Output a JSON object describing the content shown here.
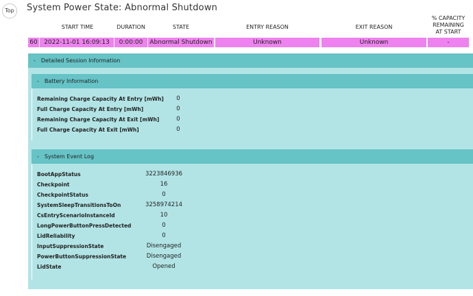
{
  "nav": {
    "top_label": "Top"
  },
  "page_title": "System Power State: Abnormal Shutdown",
  "columns": {
    "start_time": "START TIME",
    "duration": "DURATION",
    "state": "STATE",
    "entry_reason": "ENTRY REASON",
    "exit_reason": "EXIT REASON",
    "capacity_line1": "% CAPACITY",
    "capacity_line2": "REMAINING",
    "capacity_line3": "AT START"
  },
  "row": {
    "index": "60",
    "start_time": "2022-11-01   16:09:13",
    "duration": "0:00:00",
    "state": "Abnormal Shutdown",
    "entry_reason": "Unknown",
    "exit_reason": "Unknown",
    "capacity": "-"
  },
  "session": {
    "header": "Detailed Session Information",
    "toggle": "-",
    "battery": {
      "header": "Battery Information",
      "toggle": "-",
      "items": [
        {
          "label": "Remaining Charge Capacity At Entry [mWh]",
          "value": "0"
        },
        {
          "label": "Full Charge Capacity At Entry [mWh]",
          "value": "0"
        },
        {
          "label": "Remaining Charge Capacity At Exit [mWh]",
          "value": "0"
        },
        {
          "label": "Full Charge Capacity At Exit [mWh]",
          "value": "0"
        }
      ]
    },
    "events": {
      "header": "System Event Log",
      "toggle": "-",
      "items": [
        {
          "label": "BootAppStatus",
          "value": "3223846936"
        },
        {
          "label": "Checkpoint",
          "value": "16"
        },
        {
          "label": "CheckpointStatus",
          "value": "0"
        },
        {
          "label": "SystemSleepTransitionsToOn",
          "value": "3258974214"
        },
        {
          "label": "CsEntryScenarioInstanceId",
          "value": "10"
        },
        {
          "label": "LongPowerButtonPressDetected",
          "value": "0"
        },
        {
          "label": "LidReliability",
          "value": "0"
        },
        {
          "label": "InputSuppressionState",
          "value": "Disengaged"
        },
        {
          "label": "PowerButtonSuppressionState",
          "value": "Disengaged"
        },
        {
          "label": "LidState",
          "value": "Opened"
        }
      ]
    }
  },
  "colors": {
    "row_highlight": "#ee82ee",
    "section_header": "#66c3c6",
    "section_body": "#b2e4e6"
  }
}
